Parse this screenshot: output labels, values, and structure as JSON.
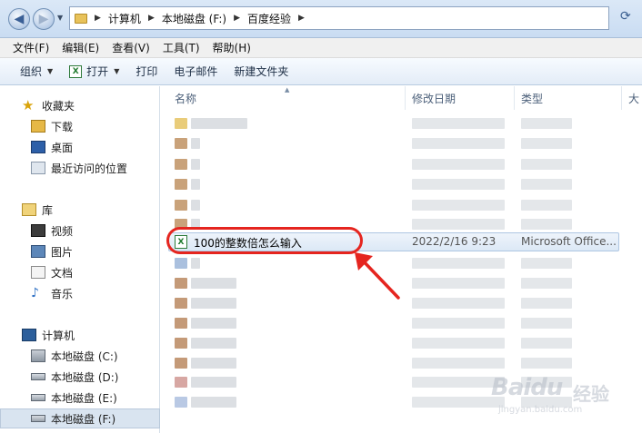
{
  "address": {
    "breadcrumbs": [
      "计算机",
      "本地磁盘 (F:)",
      "百度经验"
    ]
  },
  "menu": [
    "文件(F)",
    "编辑(E)",
    "查看(V)",
    "工具(T)",
    "帮助(H)"
  ],
  "toolbar": {
    "organize": "组织",
    "open": "打开",
    "print": "打印",
    "email": "电子邮件",
    "new_folder": "新建文件夹"
  },
  "nav": {
    "favorites": {
      "label": "收藏夹",
      "items": [
        "下载",
        "桌面",
        "最近访问的位置"
      ]
    },
    "libraries": {
      "label": "库",
      "items": [
        "视频",
        "图片",
        "文档",
        "音乐"
      ]
    },
    "computer": {
      "label": "计算机",
      "items": [
        "本地磁盘 (C:)",
        "本地磁盘 (D:)",
        "本地磁盘 (E:)",
        "本地磁盘 (F:)"
      ],
      "selected_index": 3
    }
  },
  "columns": {
    "name": "名称",
    "date": "修改日期",
    "type": "类型",
    "size": "大"
  },
  "selected_file": {
    "name": "100的整数倍怎么输入",
    "date": "2022/2/16 9:23",
    "type": "Microsoft Office..."
  },
  "watermark": {
    "brand": "Baidu",
    "suffix": "经验",
    "url": "jingyan.baidu.com"
  },
  "colors": {
    "annotation": "#e5251f",
    "selection": "#dce8f6"
  }
}
